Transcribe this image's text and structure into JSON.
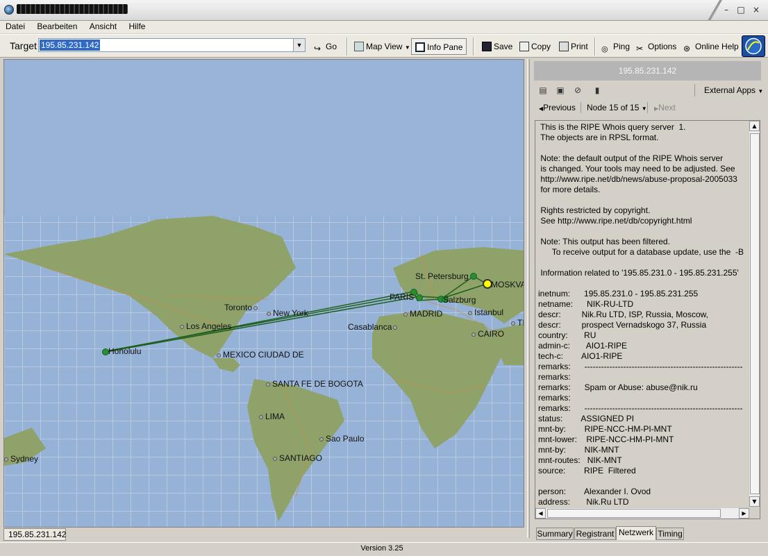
{
  "window": {
    "min_glyph": "–",
    "max_glyph": "□",
    "close_glyph": "×"
  },
  "menu": [
    "Datei",
    "Bearbeiten",
    "Ansicht",
    "Hilfe"
  ],
  "toolbar": {
    "target_label": "Target",
    "target_value": "195.85.231.142",
    "go": "Go",
    "map_view": "Map View",
    "info_pane": "Info Pane",
    "save": "Save",
    "copy": "Copy",
    "print": "Print",
    "ping": "Ping",
    "options": "Options",
    "online_help": "Online Help"
  },
  "map": {
    "cities": [
      "St. Petersburg",
      "MOSKVA",
      "PARIS",
      "Salzburg",
      "Toronto",
      "New York",
      "Los Angeles",
      "MADRID",
      "Istanbul",
      "Casablanca",
      "CAIRO",
      "Honolulu",
      "MEXICO CIUDAD DE",
      "SANTA FE DE BOGOTA",
      "LIMA",
      "Sao Paulo",
      "SANTIAGO",
      "Sydney",
      "TI"
    ],
    "tab_label": "195.85.231.142"
  },
  "info": {
    "header": "195.85.231.142",
    "external_apps": "External Apps",
    "previous": "Previous",
    "node_label": "Node 15 of 15",
    "next": "Next",
    "whois_text": " This is the RIPE Whois query server  1.\n The objects are in RPSL format.\n\n Note: the default output of the RIPE Whois server\n is changed. Your tools may need to be adjusted. See\n http://www.ripe.net/db/news/abuse-proposal-2005033\n for more details.\n\n Rights restricted by copyright.\n See http://www.ripe.net/db/copyright.html\n\n Note: This output has been filtered.\n      To receive output for a database update, use the  -B\n\n Information related to '195.85.231.0 - 195.85.231.255'\n\ninetnum:      195.85.231.0 - 195.85.231.255\nnetname:      NIK-RU-LTD\ndescr:         Nik.Ru LTD, ISP, Russia, Moscow,\ndescr:         prospect Vernadskogo 37, Russia\ncountry:       RU\nadmin-c:       AIO1-RIPE\ntech-c:        AIO1-RIPE\nremarks:      ---------------------------------------------------------\nremarks:\nremarks:      Spam or Abuse: abuse@nik.ru\nremarks:\nremarks:      ---------------------------------------------------------\nstatus:        ASSIGNED PI\nmnt-by:        RIPE-NCC-HM-PI-MNT\nmnt-lower:    RIPE-NCC-HM-PI-MNT\nmnt-by:        NIK-MNT\nmnt-routes:   NIK-MNT\nsource:        RIPE  Filtered\n\nperson:        Alexander I. Ovod\naddress:       Nik.Ru LTD",
    "tabs": [
      "Summary",
      "Registrant",
      "Netzwerk",
      "Timing"
    ]
  },
  "status": {
    "version": "Version 3.25"
  }
}
